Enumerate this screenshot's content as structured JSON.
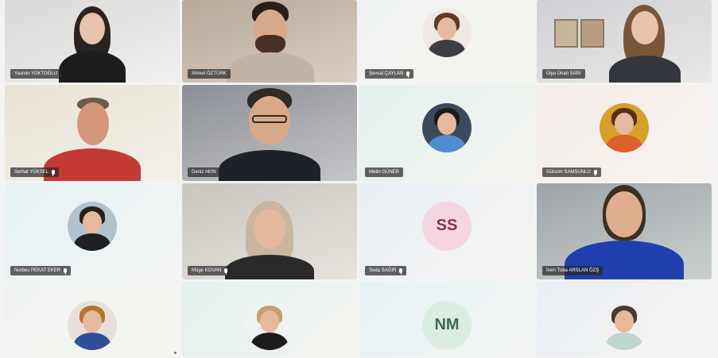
{
  "participants": [
    {
      "name": "Yasmin YÜKTOĞLU",
      "muted": false
    },
    {
      "name": "Ahmet ÖZTÜRK",
      "muted": false
    },
    {
      "name": "Şevval ÇAYLAN",
      "muted": true
    },
    {
      "name": "Ülya Ünan SARI",
      "muted": false
    },
    {
      "name": "Serhat YÜKSEL",
      "muted": true
    },
    {
      "name": "Deniz AKIN",
      "muted": false
    },
    {
      "name": "Metin GÜNER",
      "muted": false
    },
    {
      "name": "Gülsüm SAMSUNLU",
      "muted": true
    },
    {
      "name": "Nurbes PEKAT EKER",
      "muted": true
    },
    {
      "name": "Müge KOVAN",
      "muted": true
    },
    {
      "name": "Seda SAĞIR",
      "muted": true
    },
    {
      "name": "İrem Tuba ARSLAN ÖZŞ",
      "muted": false
    },
    {
      "name": "",
      "muted": false
    },
    {
      "name": "",
      "muted": false
    },
    {
      "name": "",
      "muted": false
    },
    {
      "name": "",
      "muted": false
    }
  ],
  "initials": {
    "seda": "SS",
    "nm": "NM"
  },
  "colors": {
    "label_bg": "#282828",
    "ss_bg": "#f5d6e0",
    "nm_bg": "#d9eee0"
  }
}
